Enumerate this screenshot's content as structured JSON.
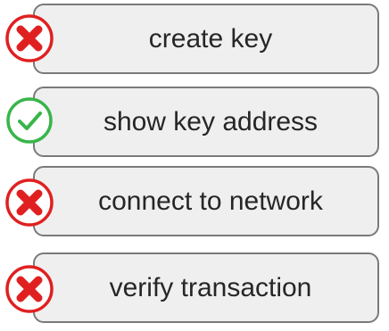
{
  "steps": [
    {
      "label": "create key",
      "status": "fail",
      "icon": "x-circle-icon"
    },
    {
      "label": "show key address",
      "status": "pass",
      "icon": "check-circle-icon"
    },
    {
      "label": "connect to network",
      "status": "fail",
      "icon": "x-circle-icon"
    },
    {
      "label": "verify transaction",
      "status": "fail",
      "icon": "x-circle-icon"
    }
  ],
  "colors": {
    "fail_fill": "#e02020",
    "fail_ring": "#e02020",
    "pass_ring": "#39b54a",
    "box_fill": "#efefef",
    "box_border": "#7a7a7a",
    "text": "#262626"
  }
}
